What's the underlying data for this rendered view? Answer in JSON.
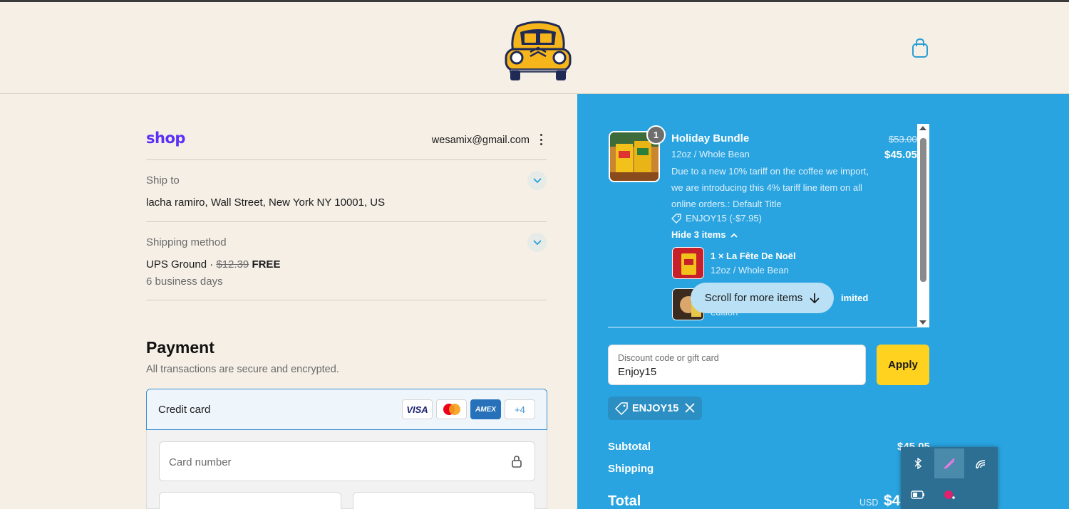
{
  "header": {
    "logo_icon": "vintage-car-logo",
    "cart_icon": "shopping-bag-icon"
  },
  "checkout": {
    "shop_label": "shop",
    "account_email": "wesamix@gmail.com",
    "ship_to": {
      "label": "Ship to",
      "value": "lacha ramiro, Wall Street, New York NY 10001, US"
    },
    "shipping_method": {
      "label": "Shipping method",
      "carrier": "UPS Ground · ",
      "original_price": "$12.39",
      "price": "FREE",
      "eta": "6 business days"
    },
    "payment": {
      "title": "Payment",
      "subtitle": "All transactions are secure and encrypted.",
      "method_label": "Credit card",
      "card_brands": [
        "VISA",
        "",
        "AMEX",
        "+4"
      ],
      "card_number_placeholder": "Card number"
    }
  },
  "order_summary": {
    "item": {
      "quantity": "1",
      "title": "Holiday Bundle",
      "variant": "12oz / Whole Bean",
      "note": "Due to a new 10% tariff on the coffee we import, we are introducing this 4% tariff line item on all online orders.: Default Title",
      "discount": "ENJOY15 (-$7.95)",
      "original_price": "$53.00",
      "price": "$45.05",
      "toggle_label": "Hide 3 items"
    },
    "sub_items": [
      {
        "title": "1 × La Fête De Noël",
        "variant": "12oz / Whole Bean"
      },
      {
        "title": "imited",
        "variant": "edition"
      }
    ],
    "scroll_hint": "Scroll for more items",
    "discount_field": {
      "label": "Discount code or gift card",
      "value": "Enjoy15"
    },
    "apply_label": "Apply",
    "applied_code": "ENJOY15",
    "subtotal_label": "Subtotal",
    "subtotal_value": "$45.05",
    "shipping_label": "Shipping",
    "total_label": "Total",
    "total_currency": "USD",
    "total_value": "$4"
  },
  "colors": {
    "brand_yellow": "#ffd21f",
    "summary_blue": "#29a4e0",
    "shop_purple": "#5a31f4",
    "page_bg": "#f5efe6"
  },
  "system_tray": {
    "icons": [
      "bluetooth-icon",
      "pen-icon",
      "wifi-icon",
      "battery-icon",
      "record-icon"
    ]
  }
}
